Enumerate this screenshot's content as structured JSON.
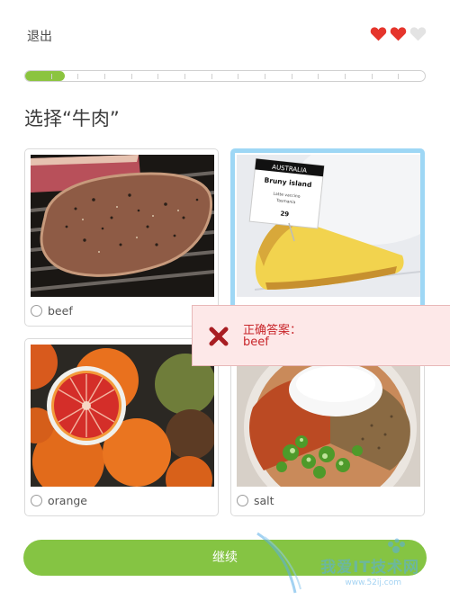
{
  "header": {
    "exit_label": "退出",
    "hearts": {
      "total": 3,
      "filled": 2,
      "filled_color": "#e5352c",
      "empty_color": "#e3e3e3"
    }
  },
  "progress": {
    "fraction": 0.1,
    "segments": 15,
    "color": "#8bc43f"
  },
  "prompt": "选择“牛肉”",
  "options": [
    {
      "label": "beef",
      "image": "grilled-steak",
      "selected": false
    },
    {
      "label": "",
      "image": "cheese-wedge",
      "selected": true,
      "photo_tag": {
        "header": "AUSTRALIA",
        "name": "Bruny island",
        "line1": "Lattе vaccino",
        "line2": "Tasmania",
        "number": "29"
      }
    },
    {
      "label": "orange",
      "image": "blood-oranges",
      "selected": false
    },
    {
      "label": "salt",
      "image": "spices-bowl",
      "selected": false
    }
  ],
  "feedback": {
    "title": "正确答案：",
    "answer": "beef",
    "color": "#c8252a"
  },
  "continue_label": "继续",
  "watermark": {
    "text": "我爱IT技术网",
    "url": "www.52ij.com"
  }
}
